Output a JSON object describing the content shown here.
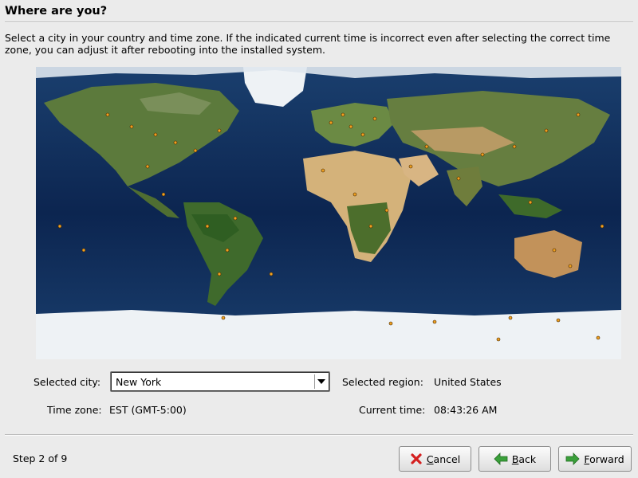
{
  "header": {
    "title": "Where are you?"
  },
  "description": "Select a city in your country and time zone. If the indicated current time is incorrect even after selecting the correct time zone, you can adjust it after rebooting into the installed system.",
  "map": {
    "icon": "world-map"
  },
  "fields": {
    "city_label": "Selected city:",
    "city_value": "New York",
    "region_label": "Selected region:",
    "region_value": "United States",
    "timezone_label": "Time zone:",
    "timezone_value": "EST (GMT-5:00)",
    "time_label": "Current time:",
    "time_value": "08:43:26 AM"
  },
  "footer": {
    "step": "Step 2 of 9",
    "cancel_mnemonic": "C",
    "cancel_rest": "ancel",
    "back_mnemonic": "B",
    "back_rest": "ack",
    "forward_mnemonic": "F",
    "forward_rest": "orward"
  },
  "colors": {
    "ocean": "#0d2750",
    "land": "#5c7a3c",
    "desert": "#d4b27a",
    "ice": "#eef2f5",
    "city_dot": "#f0a020",
    "cancel_icon": "#d42020",
    "nav_icon": "#3aa03a"
  }
}
